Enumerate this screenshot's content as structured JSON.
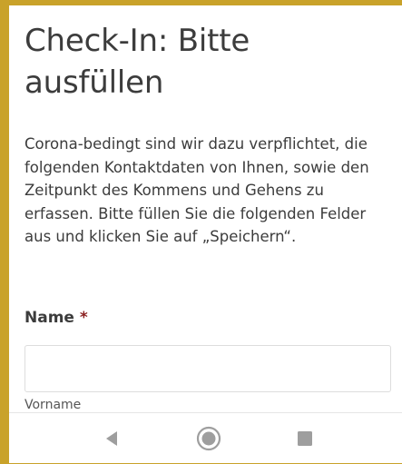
{
  "page": {
    "title": "Check-In: Bitte ausfüllen",
    "intro": "Corona-bedingt sind wir dazu verpflichtet, die folgenden Kontaktdaten von Ihnen, sowie den Zeitpunkt des Kommens und Gehens zu erfassen. Bitte füllen Sie die folgenden Felder aus und klicken Sie auf „Speichern“."
  },
  "form": {
    "name_label": "Name",
    "required_marker": "*",
    "name_value": "",
    "name_sublabel": "Vorname"
  },
  "navbar": {
    "back_icon": "back-triangle-icon",
    "home_icon": "home-circle-icon",
    "recent_icon": "recent-apps-square-icon"
  },
  "colors": {
    "accent": "#c9a22a",
    "text": "#3c3c3c",
    "required": "#8a1f1f",
    "nav_icon": "#9e9e9e"
  }
}
